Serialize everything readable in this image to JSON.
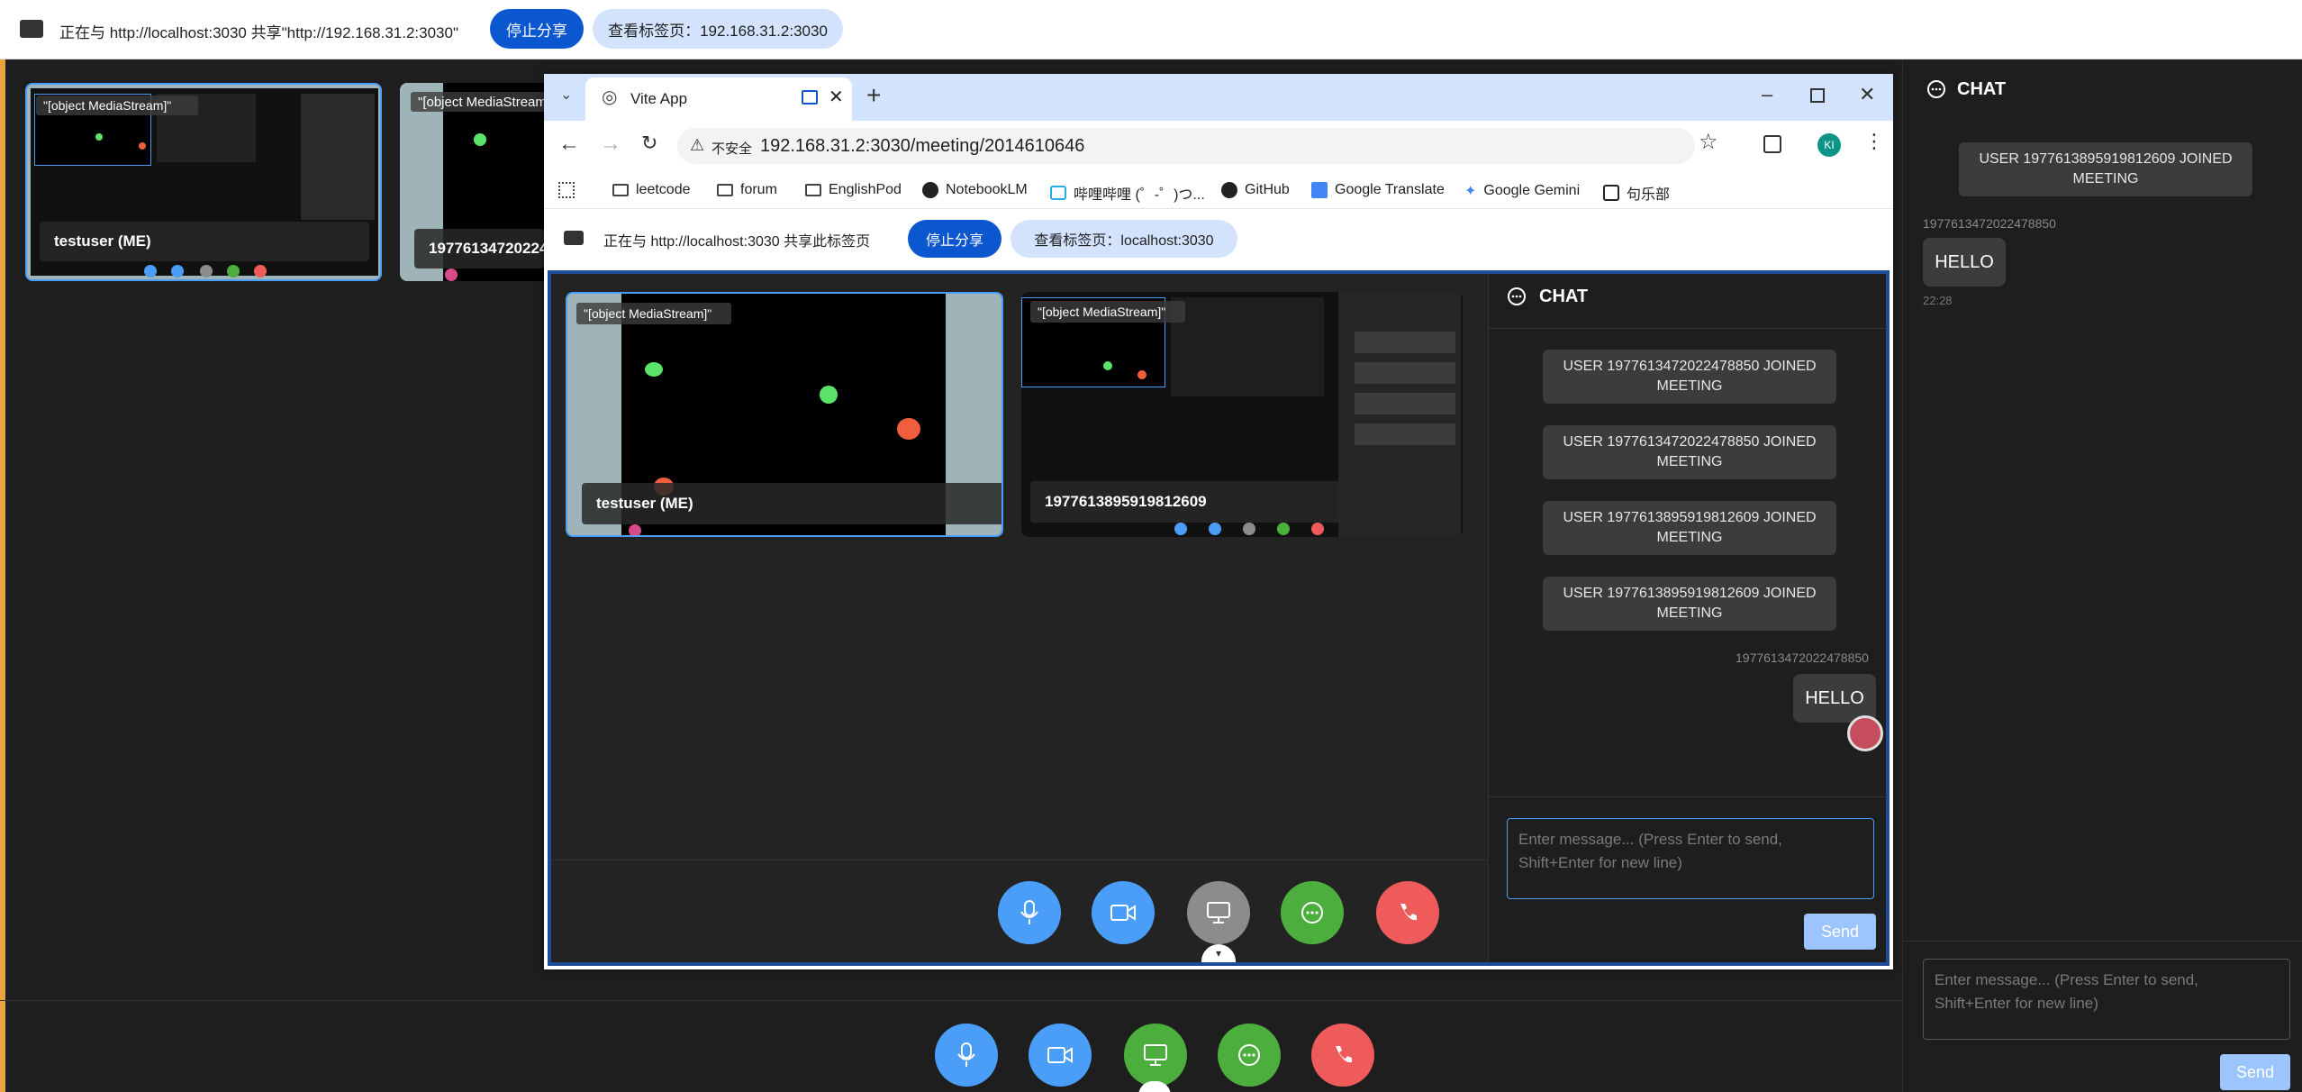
{
  "share_bar": {
    "text": "正在与 http://localhost:3030 共享\"http://192.168.31.2:3030\"",
    "stop_label": "停止分享",
    "view_label": "查看标签页：192.168.31.2:3030"
  },
  "outer_tiles": [
    {
      "media_label": "\"[object MediaStream]\"",
      "name": "testuser (ME)"
    },
    {
      "media_label": "\"[object MediaStream",
      "name": "19776134720224"
    }
  ],
  "outer_controls": [
    "mic-button",
    "camera-button",
    "screen-share-button",
    "chat-button",
    "hangup-button"
  ],
  "outer_chat": {
    "title": "CHAT",
    "system_message": "USER 1977613895919812609 JOINED MEETING",
    "sender": "1977613472022478850",
    "message": "HELLO",
    "time": "22:28",
    "input_placeholder": "Enter message... (Press Enter to send, Shift+Enter for new line)",
    "send_label": "Send"
  },
  "browser": {
    "tab_title": "Vite App",
    "insecure_label": "不安全",
    "url": "192.168.31.2:3030/meeting/2014610646",
    "profile_initials": "KI",
    "bookmarks": [
      "leetcode",
      "forum",
      "EnglishPod",
      "NotebookLM",
      "哔哩哔哩 (゜-゜)つ...",
      "GitHub",
      "Google Translate",
      "Google Gemini",
      "句乐部"
    ]
  },
  "inner_share_bar": {
    "text": "正在与 http://localhost:3030 共享此标签页",
    "stop_label": "停止分享",
    "view_label": "查看标签页：localhost:3030"
  },
  "inner_tiles": [
    {
      "media_label": "\"[object MediaStream]\"",
      "name": "testuser (ME)"
    },
    {
      "media_label": "\"[object MediaStream]\"",
      "name": "1977613895919812609"
    }
  ],
  "inner_chat": {
    "title": "CHAT",
    "system_messages": [
      "USER 1977613472022478850 JOINED MEETING",
      "USER 1977613472022478850 JOINED MEETING",
      "USER 1977613895919812609 JOINED MEETING",
      "USER 1977613895919812609 JOINED MEETING"
    ],
    "sender": "1977613472022478850",
    "message": "HELLO",
    "input_placeholder": "Enter message... (Press Enter to send, Shift+Enter for new line)",
    "send_label": "Send"
  },
  "colors": {
    "accent_blue": "#0b57d0",
    "control_blue": "#4a9ef8",
    "control_green": "#4caf3d",
    "control_red": "#ef5b5b",
    "send_disabled": "#9cc4ff"
  }
}
